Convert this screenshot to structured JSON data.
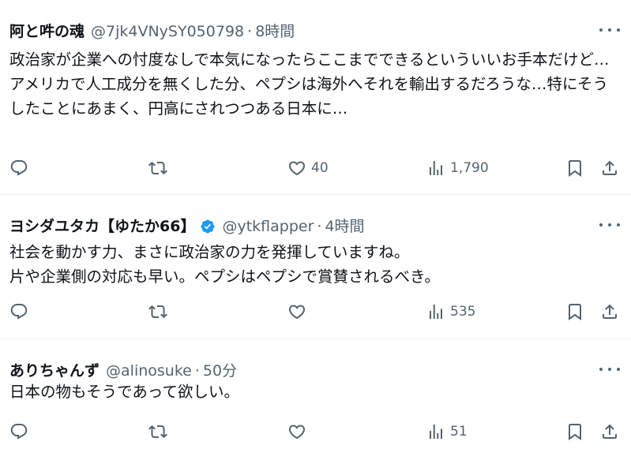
{
  "tweets": [
    {
      "name": "阿と吽の魂",
      "handle": "@7jk4VNySY050798",
      "separator": "·",
      "time": "8時間",
      "verified": false,
      "text": "政治家が企業への忖度なしで本気になったらここまでできるといういいお手本だけど…\nアメリカで人工成分を無くした分、ペプシは海外へそれを輸出するだろうな…特にそうしたことにあまく、円高にされつつある日本に…",
      "reply_count": "",
      "retweet_count": "",
      "like_count": "40",
      "view_count": "1,790"
    },
    {
      "name": "ヨシダユタカ【ゆたか66】",
      "handle": "@ytkflapper",
      "separator": "·",
      "time": "4時間",
      "verified": true,
      "text": "社会を動かす力、まさに政治家の力を発揮していますね。\n片や企業側の対応も早い。ペプシはペプシで賞賛されるべき。",
      "reply_count": "",
      "retweet_count": "",
      "like_count": "",
      "view_count": "535"
    },
    {
      "name": "ありちゃんず",
      "handle": "@alinosuke",
      "separator": "·",
      "time": "50分",
      "verified": false,
      "text": "日本の物もそうであって欲しい。",
      "reply_count": "",
      "retweet_count": "",
      "like_count": "",
      "view_count": "51"
    }
  ],
  "icons": {
    "reply": "reply-icon",
    "retweet": "retweet-icon",
    "like": "like-icon",
    "views": "views-icon",
    "bookmark": "bookmark-icon",
    "share": "share-icon",
    "more": "more-icon",
    "verified": "verified-badge-icon"
  },
  "colors": {
    "text": "#0f1419",
    "secondary": "#536471",
    "verified": "#1d9bf0",
    "divider": "#eff3f4"
  }
}
